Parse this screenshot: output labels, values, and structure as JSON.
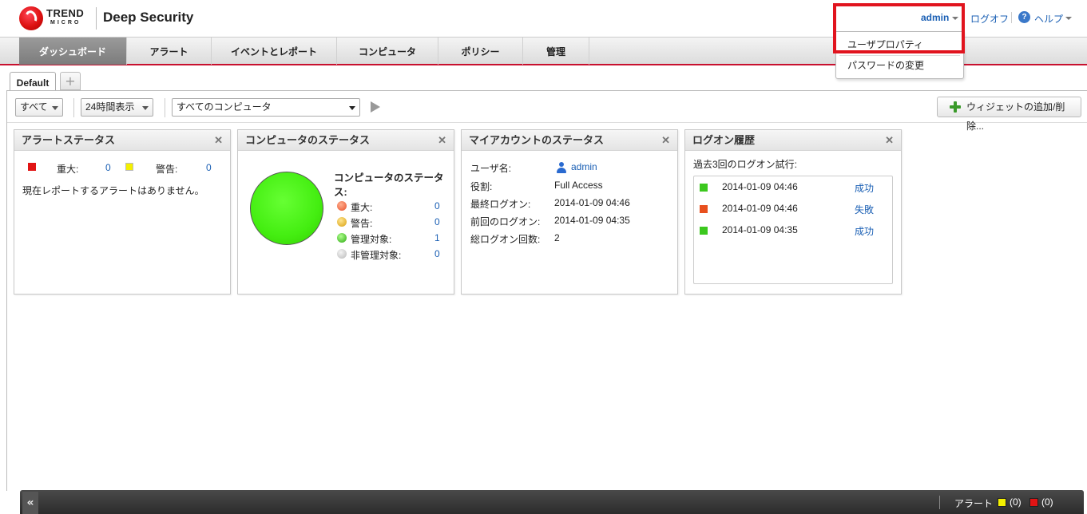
{
  "header": {
    "brand_top": "TREND",
    "brand_bottom": "MICRO",
    "product": "Deep Security",
    "user": "admin",
    "logoff": "ログオフ",
    "help": "ヘルプ"
  },
  "user_menu": {
    "items": [
      "ユーザプロパティ",
      "パスワードの変更"
    ]
  },
  "nav": {
    "tabs": [
      {
        "label": "ダッシュボード",
        "active": true
      },
      {
        "label": "アラート",
        "active": false
      },
      {
        "label": "イベントとレポート",
        "active": false
      },
      {
        "label": "コンピュータ",
        "active": false
      },
      {
        "label": "ポリシー",
        "active": false
      },
      {
        "label": "管理",
        "active": false
      }
    ]
  },
  "dashboard_tabs": {
    "current": "Default",
    "add": "+"
  },
  "toolbar": {
    "filter_all": "すべて",
    "time_range": "24時間表示",
    "computers": "すべてのコンピュータ",
    "add_widget": "ウィジェットの追加/削除..."
  },
  "alert_status": {
    "title": "アラートステータス",
    "critical_label": "重大:",
    "critical_count": "0",
    "warning_label": "警告:",
    "warning_count": "0",
    "message": "現在レポートするアラートはありません。"
  },
  "computer_status": {
    "title": "コンピュータのステータス",
    "heading_line1": "コンピュータのステータ",
    "heading_line2": "ス:",
    "rows": [
      {
        "label": "重大:",
        "value": "0",
        "color": "#e8502a"
      },
      {
        "label": "警告:",
        "value": "0",
        "color": "#e8b82a"
      },
      {
        "label": "管理対象:",
        "value": "1",
        "color": "#3cc81e"
      },
      {
        "label": "非管理対象:",
        "value": "0",
        "color": "#c8c8c8"
      }
    ]
  },
  "account_status": {
    "title": "マイアカウントのステータス",
    "rows": [
      {
        "label": "ユーザ名:",
        "value": "admin"
      },
      {
        "label": "役割:",
        "value": "Full Access"
      },
      {
        "label": "最終ログオン:",
        "value": "2014-01-09 04:46"
      },
      {
        "label": "前回のログオン:",
        "value": "2014-01-09 04:35"
      },
      {
        "label": "総ログオン回数:",
        "value": "2"
      }
    ]
  },
  "logon_history": {
    "title": "ログオン履歴",
    "subtitle": "過去3回のログオン試行:",
    "rows": [
      {
        "time": "2014-01-09 04:46",
        "result": "成功",
        "color": "#3cc81e"
      },
      {
        "time": "2014-01-09 04:46",
        "result": "失敗",
        "color": "#e8501e"
      },
      {
        "time": "2014-01-09 04:35",
        "result": "成功",
        "color": "#3cc81e"
      }
    ]
  },
  "footer": {
    "collapse": "«",
    "alerts_label": "アラート",
    "warning_count": "(0)",
    "critical_count": "(0)"
  },
  "colors": {
    "accent": "#c8102e",
    "link": "#1a5fb4",
    "warning": "#f4f000",
    "critical": "#e11414"
  }
}
